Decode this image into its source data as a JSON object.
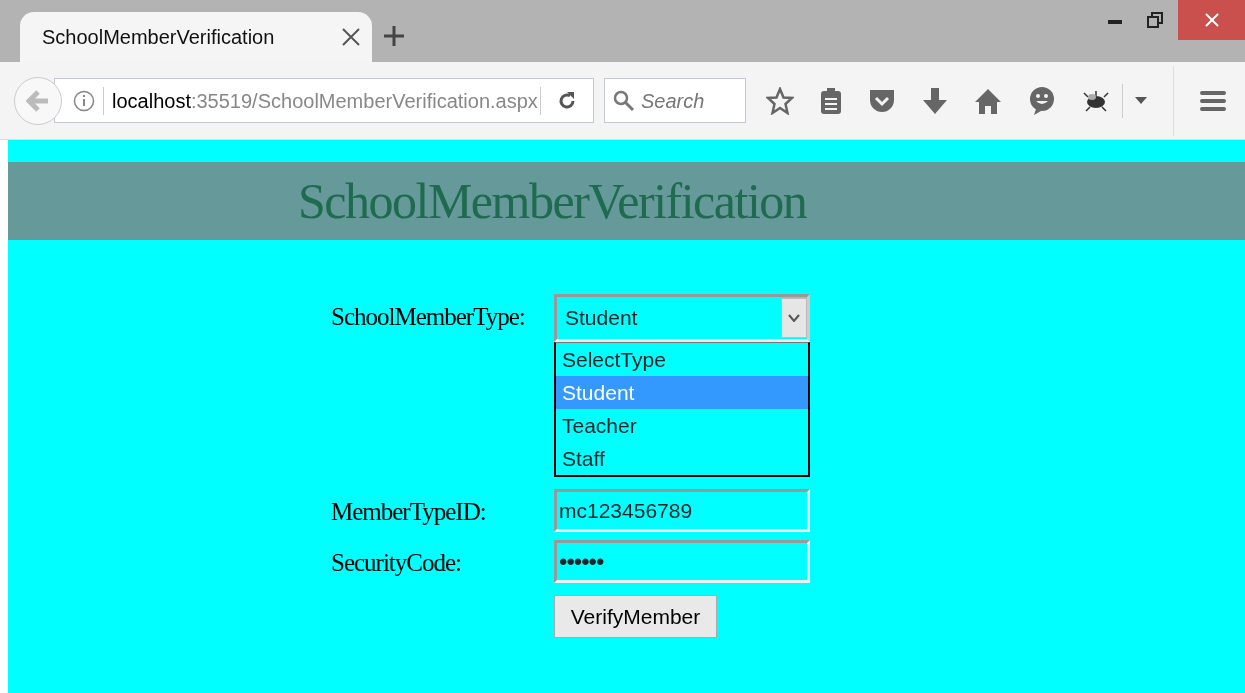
{
  "tab": {
    "title": "SchoolMemberVerification"
  },
  "address_bar": {
    "host": "localhost",
    "path": ":35519/SchoolMemberVerification.aspx"
  },
  "search": {
    "placeholder": "Search"
  },
  "page": {
    "heading": "SchoolMemberVerification",
    "fields": [
      {
        "kind": "select",
        "label": "SchoolMemberType:",
        "value": "Student",
        "expanded": true,
        "options": [
          {
            "label": "SelectType",
            "selected": false
          },
          {
            "label": "Student",
            "selected": true
          },
          {
            "label": "Teacher",
            "selected": false
          },
          {
            "label": "Staff",
            "selected": false
          }
        ]
      },
      {
        "kind": "text",
        "label": "MemberTypeID:",
        "value": "mc123456789"
      },
      {
        "kind": "password",
        "label": "SecurityCode:",
        "value": "••••••"
      }
    ],
    "button": "VerifyMember"
  }
}
